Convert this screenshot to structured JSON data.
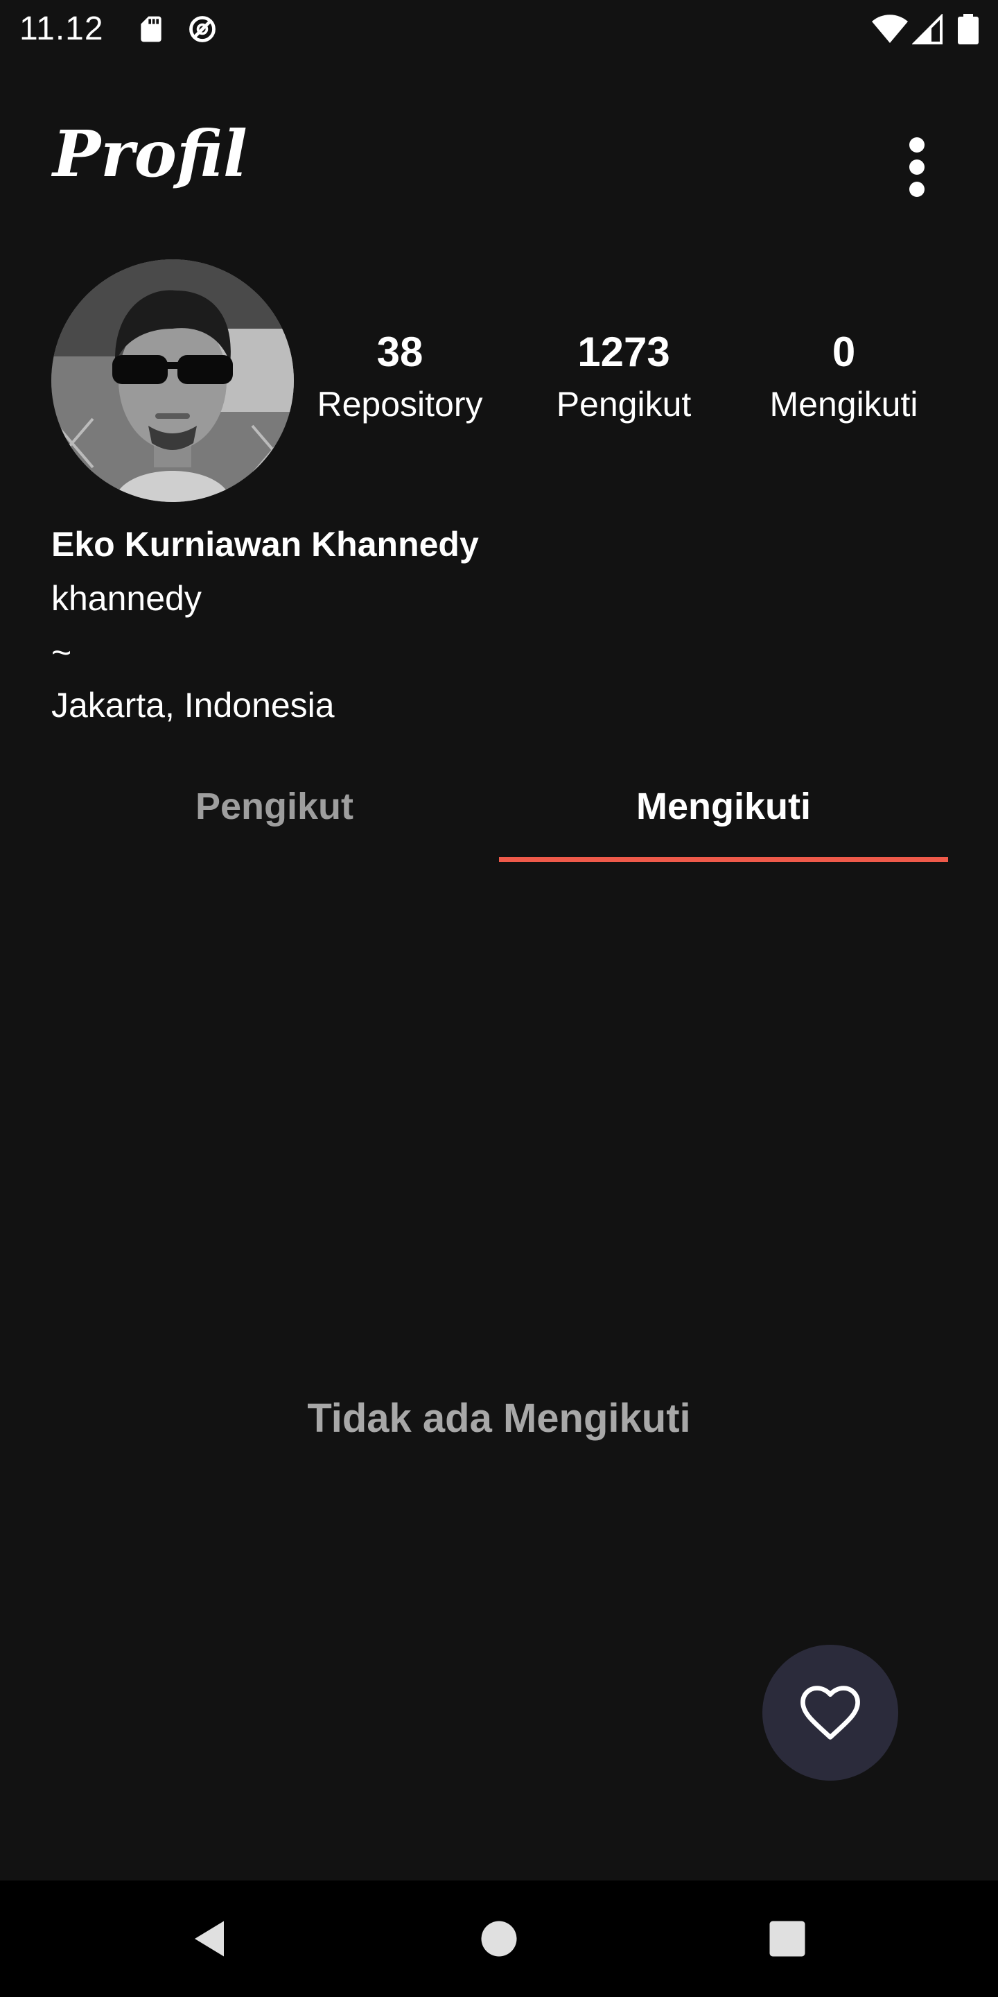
{
  "status_bar": {
    "time": "11.12",
    "icons": [
      "sd-card-icon",
      "data-saver-icon",
      "wifi-icon",
      "cell-signal-icon",
      "battery-icon"
    ]
  },
  "header": {
    "title": "Profil",
    "menu_icon": "more-vert-icon"
  },
  "profile": {
    "stats": [
      {
        "value": "38",
        "label": "Repository"
      },
      {
        "value": "1273",
        "label": "Pengikut"
      },
      {
        "value": "0",
        "label": "Mengikuti"
      }
    ],
    "full_name": "Eko Kurniawan Khannedy",
    "username": "khannedy",
    "bio": "~",
    "location": "Jakarta, Indonesia"
  },
  "tabs": [
    {
      "label": "Pengikut",
      "selected": false
    },
    {
      "label": "Mengikuti",
      "selected": true
    }
  ],
  "empty_state": {
    "message": "Tidak ada Mengikuti"
  },
  "fab": {
    "icon": "heart-outline-icon"
  },
  "nav_bar": {
    "buttons": [
      "back-icon",
      "home-icon",
      "recents-icon"
    ]
  },
  "colors": {
    "background": "#121212",
    "accent": "#ef5a4a",
    "fab_background": "#2b2b3b",
    "inactive_tab": "#9e9e9e"
  }
}
